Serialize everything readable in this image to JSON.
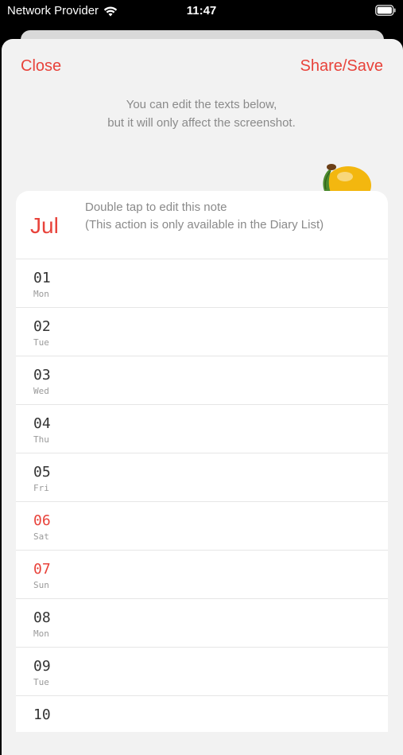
{
  "status_bar": {
    "carrier": "Network Provider",
    "time": "11:47"
  },
  "nav": {
    "close_label": "Close",
    "share_label": "Share/Save"
  },
  "hint": {
    "line1": "You can edit the texts below,",
    "line2": "but it will only affect the screenshot."
  },
  "card": {
    "month": "Jul",
    "note_line1": "Double tap to edit this note",
    "note_line2": "(This action is only available in the Diary List)"
  },
  "days": [
    {
      "num": "01",
      "name": "Mon",
      "weekend": false
    },
    {
      "num": "02",
      "name": "Tue",
      "weekend": false
    },
    {
      "num": "03",
      "name": "Wed",
      "weekend": false
    },
    {
      "num": "04",
      "name": "Thu",
      "weekend": false
    },
    {
      "num": "05",
      "name": "Fri",
      "weekend": false
    },
    {
      "num": "06",
      "name": "Sat",
      "weekend": true
    },
    {
      "num": "07",
      "name": "Sun",
      "weekend": true
    },
    {
      "num": "08",
      "name": "Mon",
      "weekend": false
    },
    {
      "num": "09",
      "name": "Tue",
      "weekend": false
    },
    {
      "num": "10",
      "name": "",
      "weekend": false
    }
  ],
  "colors": {
    "accent": "#e8433b",
    "muted_text": "#8a8a8a",
    "sheet_bg": "#f2f2f2",
    "card_bg": "#ffffff"
  },
  "icons": {
    "wifi": "wifi-icon",
    "battery": "battery-icon",
    "lemon": "lemon-icon"
  }
}
